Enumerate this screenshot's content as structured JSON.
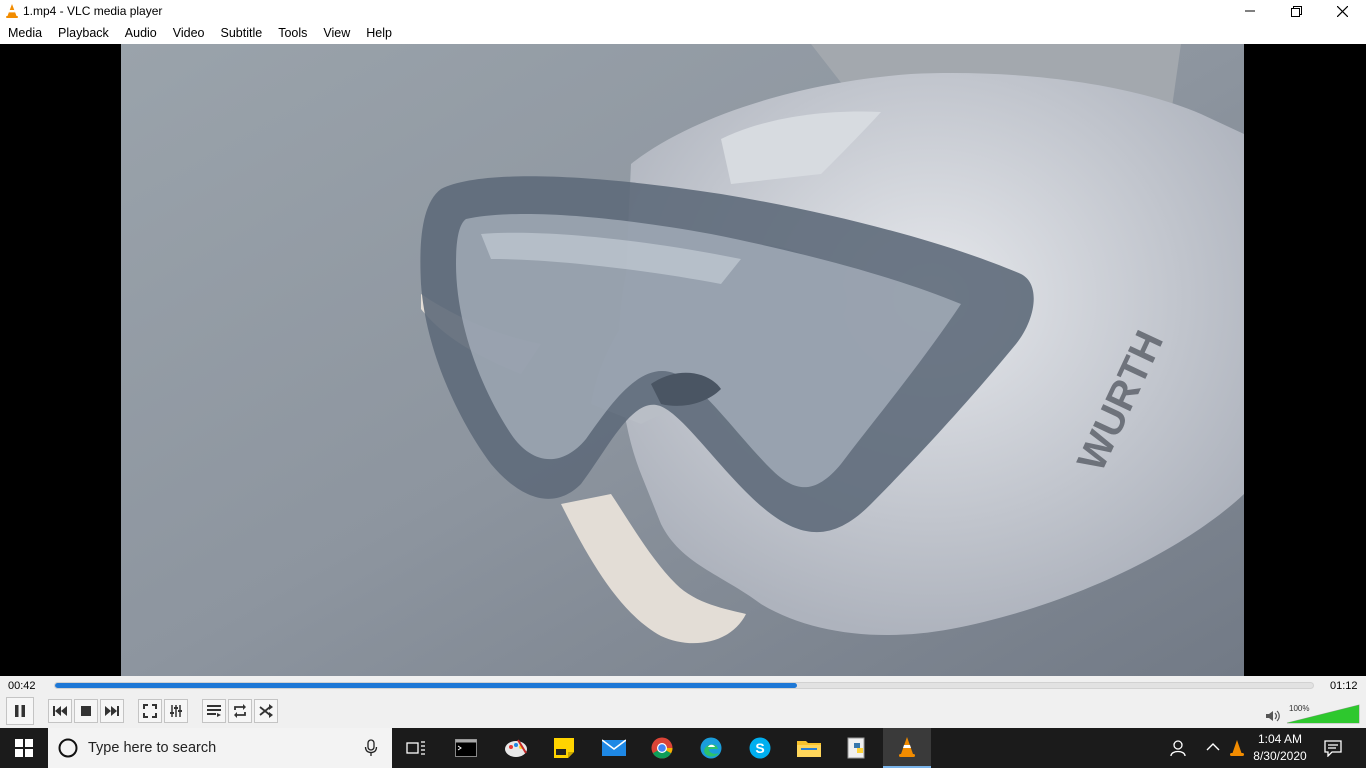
{
  "window": {
    "title": "1.mp4 - VLC media player"
  },
  "menu": [
    "Media",
    "Playback",
    "Audio",
    "Video",
    "Subtitle",
    "Tools",
    "View",
    "Help"
  ],
  "player": {
    "elapsed": "00:42",
    "total": "01:12",
    "progress": 0.59,
    "volume_label": "100%",
    "volume_level": 1.0
  },
  "taskbar": {
    "search_placeholder": "Type here to search",
    "time": "1:04 AM",
    "date": "8/30/2020",
    "apps": [
      "command-prompt",
      "paint",
      "sticky-notes",
      "mail",
      "chrome",
      "edge",
      "skype",
      "file-explorer",
      "python",
      "vlc"
    ]
  },
  "colors": {
    "accent": "#1e78d6",
    "taskbar": "#1b1b1b",
    "vlc_orange": "#f28c00"
  }
}
